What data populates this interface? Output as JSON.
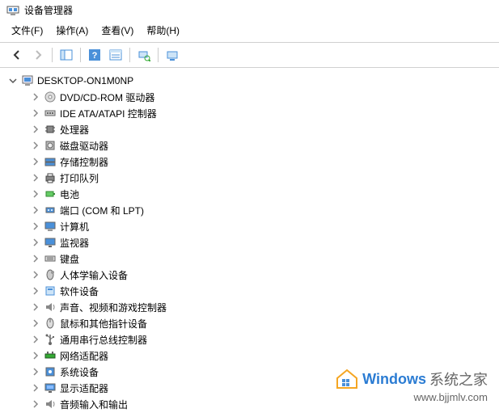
{
  "window": {
    "title": "设备管理器"
  },
  "menu": {
    "file": "文件(F)",
    "action": "操作(A)",
    "view": "查看(V)",
    "help": "帮助(H)"
  },
  "tree": {
    "root": {
      "label": "DESKTOP-ON1M0NP",
      "expanded": true
    },
    "items": [
      {
        "icon": "disc",
        "label": "DVD/CD-ROM 驱动器"
      },
      {
        "icon": "ide",
        "label": "IDE ATA/ATAPI 控制器"
      },
      {
        "icon": "cpu",
        "label": "处理器"
      },
      {
        "icon": "disk",
        "label": "磁盘驱动器"
      },
      {
        "icon": "storage",
        "label": "存储控制器"
      },
      {
        "icon": "printer",
        "label": "打印队列"
      },
      {
        "icon": "battery",
        "label": "电池"
      },
      {
        "icon": "port",
        "label": "端口 (COM 和 LPT)"
      },
      {
        "icon": "computer",
        "label": "计算机"
      },
      {
        "icon": "monitor",
        "label": "监视器"
      },
      {
        "icon": "keyboard",
        "label": "键盘"
      },
      {
        "icon": "hid",
        "label": "人体学输入设备"
      },
      {
        "icon": "software",
        "label": "软件设备"
      },
      {
        "icon": "sound",
        "label": "声音、视频和游戏控制器"
      },
      {
        "icon": "mouse",
        "label": "鼠标和其他指针设备"
      },
      {
        "icon": "usb",
        "label": "通用串行总线控制器"
      },
      {
        "icon": "network",
        "label": "网络适配器"
      },
      {
        "icon": "system",
        "label": "系统设备"
      },
      {
        "icon": "display",
        "label": "显示适配器"
      },
      {
        "icon": "audio",
        "label": "音频输入和输出"
      }
    ]
  },
  "watermark": {
    "brand": "Windows",
    "suffix": "系统之家",
    "url": "www.bjjmlv.com"
  }
}
